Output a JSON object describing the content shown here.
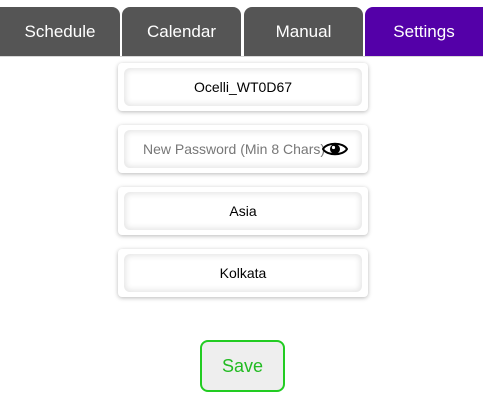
{
  "tabs": [
    {
      "label": "Schedule",
      "active": false
    },
    {
      "label": "Calendar",
      "active": false
    },
    {
      "label": "Manual",
      "active": false
    },
    {
      "label": "Settings",
      "active": true
    }
  ],
  "settings": {
    "device_name": "Ocelli_WT0D67",
    "password": {
      "value": "",
      "placeholder": "New Password (Min 8 Chars)",
      "visibility_icon": "eye-icon"
    },
    "region": "Asia",
    "city": "Kolkata"
  },
  "save_button": {
    "label": "Save"
  },
  "colors": {
    "tab_background": "#555555",
    "tab_active": "#5400a8",
    "tab_text": "#ffffff",
    "save_border": "#22cc22",
    "save_text": "#22bb22",
    "save_background": "#eeeeee"
  }
}
